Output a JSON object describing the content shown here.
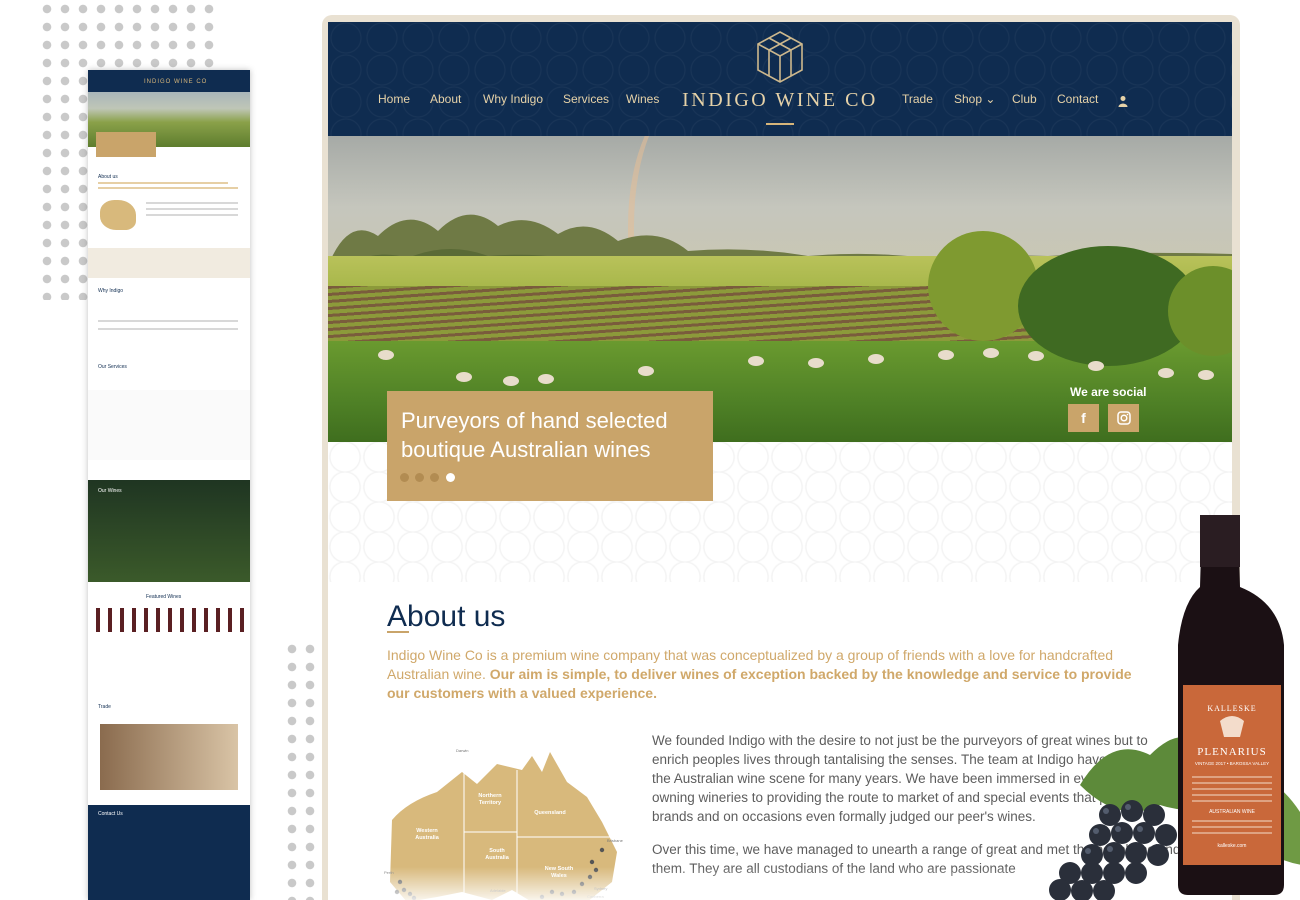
{
  "header": {
    "brand": "INDIGO WINE CO",
    "nav_left": [
      "Home",
      "About",
      "Why Indigo",
      "Services",
      "Wines"
    ],
    "nav_right": [
      "Trade",
      "Shop",
      "Club",
      "Contact"
    ],
    "shop_chevron": "⌄"
  },
  "hero": {
    "caption": "Purveyors of hand selected boutique Australian wines",
    "slides_total": 4,
    "active_slide": 4,
    "social_label": "We are social",
    "social_icons": [
      "facebook-icon",
      "instagram-icon"
    ]
  },
  "about": {
    "title": "About us",
    "lead_plain": "Indigo Wine Co is a premium wine company that was conceptualized by a group of friends with a love for handcrafted Australian wine. ",
    "lead_bold": "Our aim is simple, to deliver wines of exception backed by the knowledge and service to provide our customers with a valued experience.",
    "body": [
      "We founded Indigo with the desire to not just be the purveyors of great wines but to enrich peoples lives through tantalising the senses. The team at Indigo have traversed the Australian wine scene for many years. We have been immersed in every aspect from owning wineries to providing the route to market of and special events that promote the brands and on occasions even formally judged our peer's wines.",
      "Over this time, we have managed to unearth a range of great and met the people behind them. They are all custodians of the land who are passionate"
    ],
    "map_labels": [
      "Western Australia",
      "Northern Territory",
      "South Australia",
      "Queensland",
      "New South Wales",
      "Darwin",
      "Brisbane",
      "Sydney",
      "Canberra",
      "ACT",
      "Adelaide",
      "Perth"
    ]
  },
  "bottle": {
    "brand": "KALLESKE",
    "wine": "PLENARIUS",
    "vintage": "VINTAGE 2017 • BAROSSA VALLEY",
    "type": "AUSTRALIAN WINE",
    "site": "kalleske.com"
  },
  "mini_preview": {
    "brand": "INDIGO WINE CO",
    "sections": [
      "About us",
      "Why Indigo",
      "Our Services",
      "Our Wines",
      "Featured Wines",
      "Trade",
      "Contact Us"
    ]
  },
  "colors": {
    "navy": "#0f2c50",
    "gold": "#c9a46a",
    "nav_text": "#e6d2a8"
  }
}
